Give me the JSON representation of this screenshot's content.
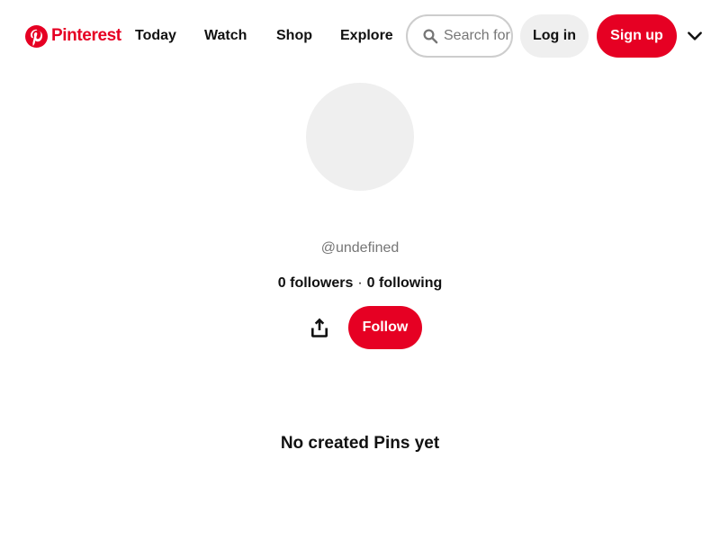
{
  "brand": {
    "name": "Pinterest",
    "color": "#e60023",
    "icon": "pinterest-logo-icon"
  },
  "nav": {
    "items": [
      {
        "label": "Today"
      },
      {
        "label": "Watch"
      },
      {
        "label": "Shop"
      },
      {
        "label": "Explore"
      }
    ]
  },
  "search": {
    "placeholder": "Search for",
    "value": "",
    "icon": "search-icon"
  },
  "header_buttons": {
    "login": "Log in",
    "signup": "Sign up",
    "settings_icon": "chevron-down-icon"
  },
  "profile": {
    "username": "@undefined",
    "followers_count": "0",
    "followers_label": "followers",
    "following_count": "0",
    "following_label": "following",
    "separator": "·",
    "share_icon": "share-icon",
    "follow_label": "Follow"
  },
  "pins": {
    "empty_message": "No created Pins yet"
  },
  "colors": {
    "accent": "#e60023",
    "secondary_button": "#efefef",
    "avatar_placeholder": "#efefef",
    "muted_text": "#767676"
  }
}
